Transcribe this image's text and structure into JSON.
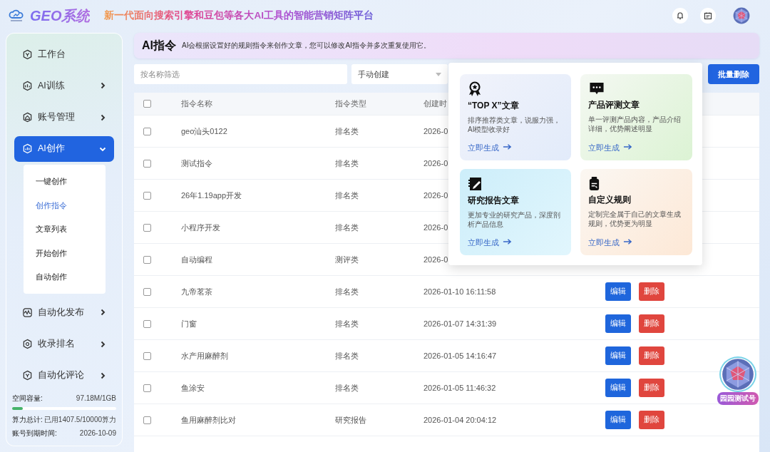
{
  "header": {
    "title": "GEO系统",
    "tagline": "新一代面向搜索引擎和豆包等各大AI工具的智能营销矩阵平台"
  },
  "sidebar": {
    "items": [
      {
        "kind": "link",
        "label": "工作台",
        "selected": false
      },
      {
        "kind": "group",
        "label": "AI训练",
        "expanded": false,
        "selected": false
      },
      {
        "kind": "group",
        "label": "账号管理",
        "expanded": false,
        "selected": false
      },
      {
        "kind": "group",
        "label": "AI创作",
        "expanded": true,
        "selected": true,
        "children": [
          {
            "label": "一键创作",
            "selected": false
          },
          {
            "label": "创作指令",
            "selected": true
          },
          {
            "label": "文章列表",
            "selected": false
          },
          {
            "label": "开始创作",
            "selected": false
          },
          {
            "label": "自动创作",
            "selected": false
          }
        ]
      },
      {
        "kind": "group",
        "label": "自动化发布",
        "expanded": false,
        "selected": false
      },
      {
        "kind": "group",
        "label": "收录排名",
        "expanded": false,
        "selected": false
      },
      {
        "kind": "group",
        "label": "自动化评论",
        "expanded": false,
        "selected": false
      }
    ],
    "storage": {
      "label": "空间容量:",
      "value": "97.18M/1GB",
      "level": 0.1
    },
    "compute": {
      "label": "算力总计:",
      "value": "已用1407.5/10000算力"
    },
    "expiry": {
      "label": "账号到期时间:",
      "value": "2026-10-09"
    }
  },
  "banner": {
    "title": "AI指令",
    "description": "AI会根据设置好的规则指令来创作文章，您可以修改AI指令并多次重复使用它。"
  },
  "filters": {
    "search": {
      "placeholder": "按名称筛选"
    },
    "select": {
      "value": "手动创建"
    },
    "batch_button": "批量删除"
  },
  "table": {
    "header_checked": false,
    "columns": [
      "指令名称",
      "指令类型",
      "创建时"
    ],
    "rows": [
      {
        "checked": false,
        "name": "geo汕头0122",
        "type": "排名类",
        "created": "2026-0"
      },
      {
        "checked": false,
        "name": "测试指令",
        "type": "排名类",
        "created": "2026-0"
      },
      {
        "checked": false,
        "name": "26年1.19app开发",
        "type": "排名类",
        "created": "2026-0"
      },
      {
        "checked": false,
        "name": "小程序开发",
        "type": "排名类",
        "created": "2026-0"
      },
      {
        "checked": false,
        "name": "自动编程",
        "type": "测评类",
        "created": "2026-0"
      },
      {
        "checked": false,
        "name": "九帝茗茶",
        "type": "排名类",
        "created": "2026-01-10 16:11:58",
        "edit": "编辑",
        "delete": "删除"
      },
      {
        "checked": false,
        "name": "门窗",
        "type": "排名类",
        "created": "2026-01-07 14:31:39",
        "edit": "编辑",
        "delete": "删除"
      },
      {
        "checked": false,
        "name": "水产用麻醉剂",
        "type": "排名类",
        "created": "2026-01-05 14:16:47",
        "edit": "编辑",
        "delete": "删除"
      },
      {
        "checked": false,
        "name": "鱼涂安",
        "type": "排名类",
        "created": "2026-01-05 11:46:32",
        "edit": "编辑",
        "delete": "删除"
      },
      {
        "checked": false,
        "name": "鱼用麻醉剂比对",
        "type": "研究报告",
        "created": "2026-01-04 20:04:12",
        "edit": "编辑",
        "delete": "删除"
      }
    ]
  },
  "popup": {
    "cards": [
      {
        "kind": "ranking",
        "title": "“TOP X”文章",
        "description": "排序推荐类文章，说服力强，AI模型收录好",
        "link": "立即生成"
      },
      {
        "kind": "review",
        "title": "产品评测文章",
        "description": "单一评测产品内容，产品介绍详细，优势阐述明显",
        "link": "立即生成"
      },
      {
        "kind": "research",
        "title": "研究报告文章",
        "description": "更加专业的研究产品，深度剖析产品信息",
        "link": "立即生成"
      },
      {
        "kind": "custom",
        "title": "自定义规则",
        "description": "定制完全属于自己的文章生成规则，优势更为明显",
        "link": "立即生成"
      }
    ]
  },
  "floating_badge": {
    "label": "园园测试号"
  }
}
